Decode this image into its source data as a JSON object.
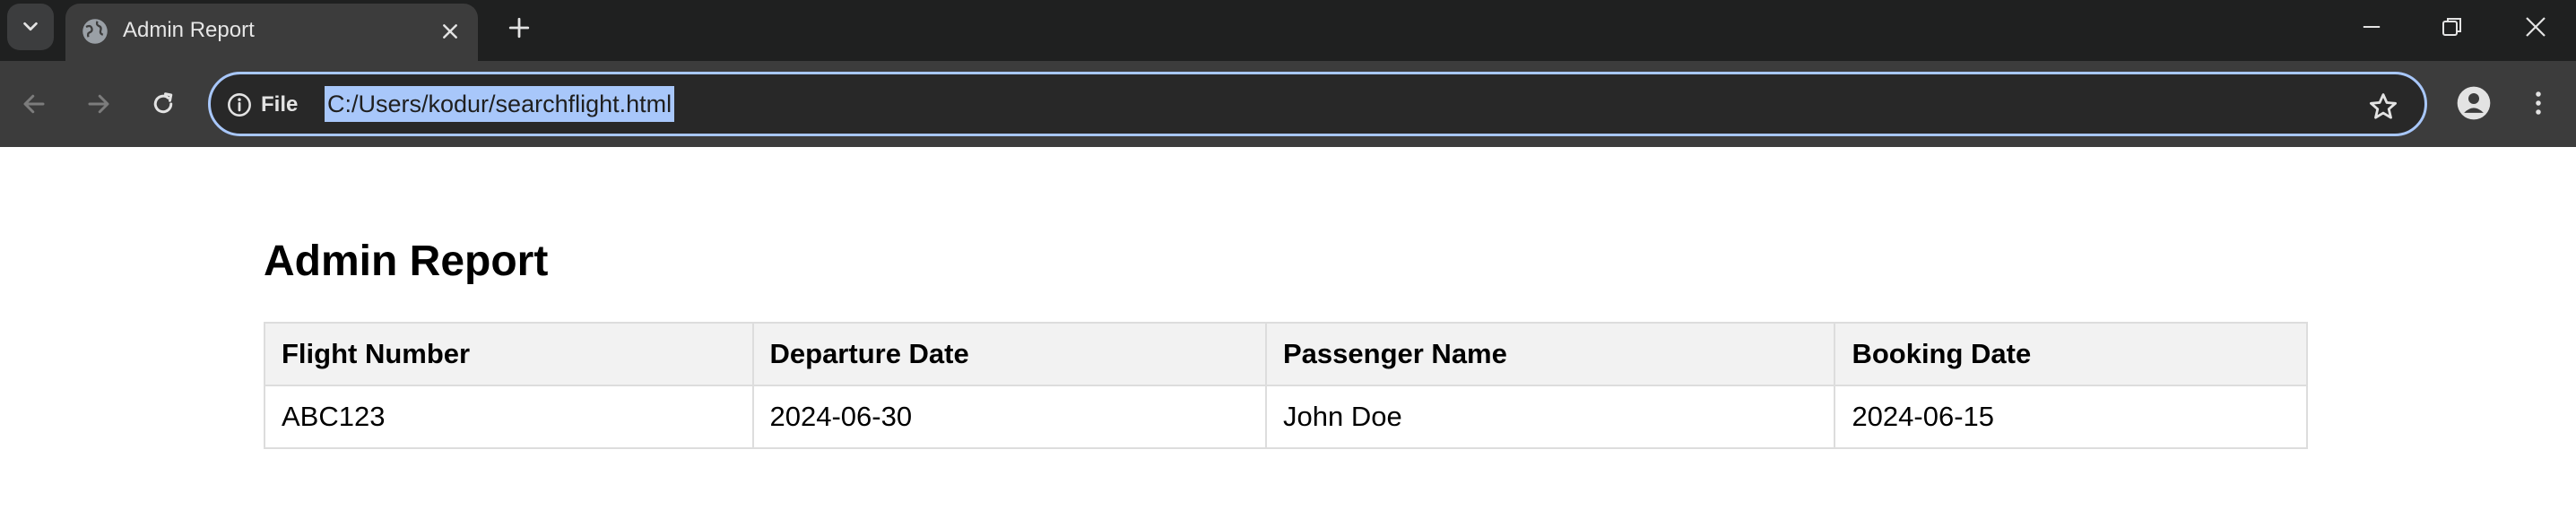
{
  "browser": {
    "tab": {
      "title": "Admin Report",
      "favicon": "globe-icon"
    },
    "address_bar": {
      "site_info_label": "File",
      "url": "C:/Users/kodur/searchflight.html"
    },
    "icons": [
      "chevron-down-icon",
      "close-icon",
      "plus-icon",
      "minimize-icon",
      "restore-icon",
      "close-window-icon",
      "back-arrow-icon",
      "forward-arrow-icon",
      "reload-icon",
      "info-icon",
      "star-icon",
      "profile-icon",
      "kebab-menu-icon"
    ],
    "colors": {
      "tabstrip": "#1f2020",
      "toolbar": "#3c3c3c",
      "omnibox_border": "#a8c7fa",
      "selection": "#a8c7fa"
    }
  },
  "page": {
    "title": "Admin Report",
    "table": {
      "headers": [
        "Flight Number",
        "Departure Date",
        "Passenger Name",
        "Booking Date"
      ],
      "rows": [
        [
          "ABC123",
          "2024-06-30",
          "John Doe",
          "2024-06-15"
        ]
      ]
    }
  }
}
